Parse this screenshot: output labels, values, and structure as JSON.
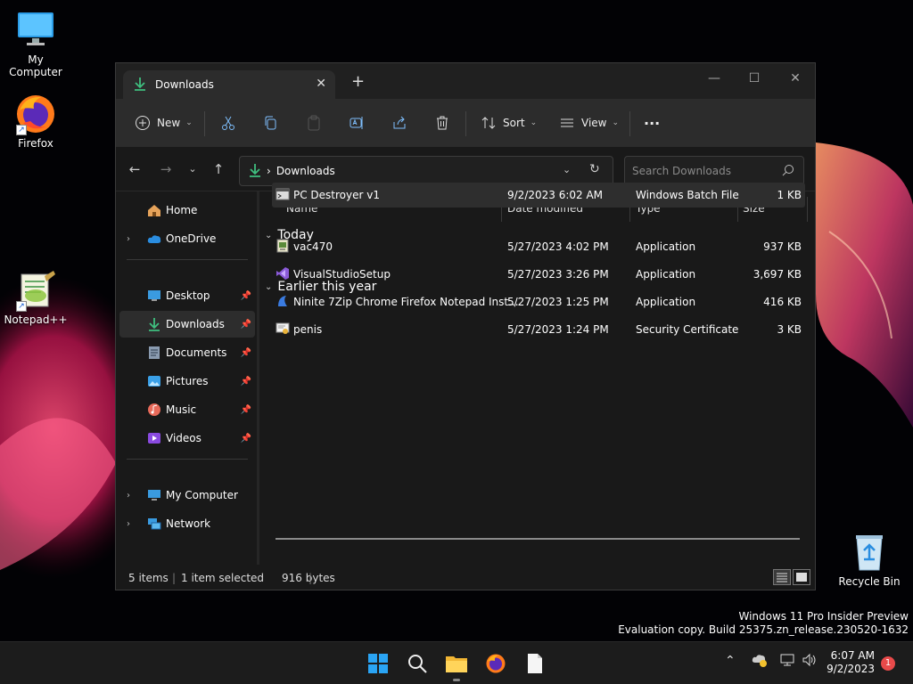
{
  "desktop": {
    "icons": [
      {
        "label": "My Computer",
        "icon": "monitor-icon"
      },
      {
        "label": "Firefox",
        "icon": "firefox-icon"
      },
      {
        "label": "Notepad++",
        "icon": "notepadpp-icon"
      },
      {
        "label": "Recycle Bin",
        "icon": "recycle-bin-icon"
      }
    ],
    "watermark": {
      "line1": "Windows 11 Pro Insider Preview",
      "line2": "Evaluation copy. Build 25375.zn_release.230520-1632"
    }
  },
  "window": {
    "tab_title": "Downloads",
    "tab_close": "✕",
    "new_tab": "+",
    "controls": {
      "minimize": "—",
      "maximize": "☐",
      "close": "✕"
    },
    "toolbar": {
      "new_label": "New",
      "sort_label": "Sort",
      "view_label": "View",
      "more_label": "···"
    },
    "address": {
      "separator": "›",
      "crumb": "Downloads",
      "search_placeholder": "Search Downloads"
    },
    "nav": {
      "home": "Home",
      "onedrive": "OneDrive",
      "quick": [
        {
          "label": "Desktop",
          "icon": "desktop-folder-icon"
        },
        {
          "label": "Downloads",
          "icon": "downloads-folder-icon"
        },
        {
          "label": "Documents",
          "icon": "documents-folder-icon"
        },
        {
          "label": "Pictures",
          "icon": "pictures-folder-icon"
        },
        {
          "label": "Music",
          "icon": "music-folder-icon"
        },
        {
          "label": "Videos",
          "icon": "videos-folder-icon"
        }
      ],
      "my_computer": "My Computer",
      "network": "Network"
    },
    "columns": {
      "name": "Name",
      "date": "Date modified",
      "type": "Type",
      "size": "Size"
    },
    "groups": {
      "today": "Today",
      "earlier": "Earlier this year"
    },
    "files_today": [
      {
        "name": "PC Destroyer v1",
        "date": "9/2/2023 6:02 AM",
        "type": "Windows Batch File",
        "size": "1 KB",
        "icon": "batch-file-icon"
      }
    ],
    "files_earlier": [
      {
        "name": "vac470",
        "date": "5/27/2023 4:02 PM",
        "type": "Application",
        "size": "937 KB",
        "icon": "installer-icon"
      },
      {
        "name": "VisualStudioSetup",
        "date": "5/27/2023 3:26 PM",
        "type": "Application",
        "size": "3,697 KB",
        "icon": "visual-studio-icon"
      },
      {
        "name": "Ninite 7Zip Chrome Firefox Notepad Inst...",
        "date": "5/27/2023 1:25 PM",
        "type": "Application",
        "size": "416 KB",
        "icon": "ninite-icon"
      },
      {
        "name": "penis",
        "date": "5/27/2023 1:24 PM",
        "type": "Security Certificate",
        "size": "3 KB",
        "icon": "certificate-icon"
      }
    ],
    "status": {
      "items": "5 items",
      "selected": "1 item selected",
      "bytes": "916 bytes"
    }
  },
  "taskbar": {
    "time": "6:07 AM",
    "date": "9/2/2023",
    "notification_count": "1"
  }
}
